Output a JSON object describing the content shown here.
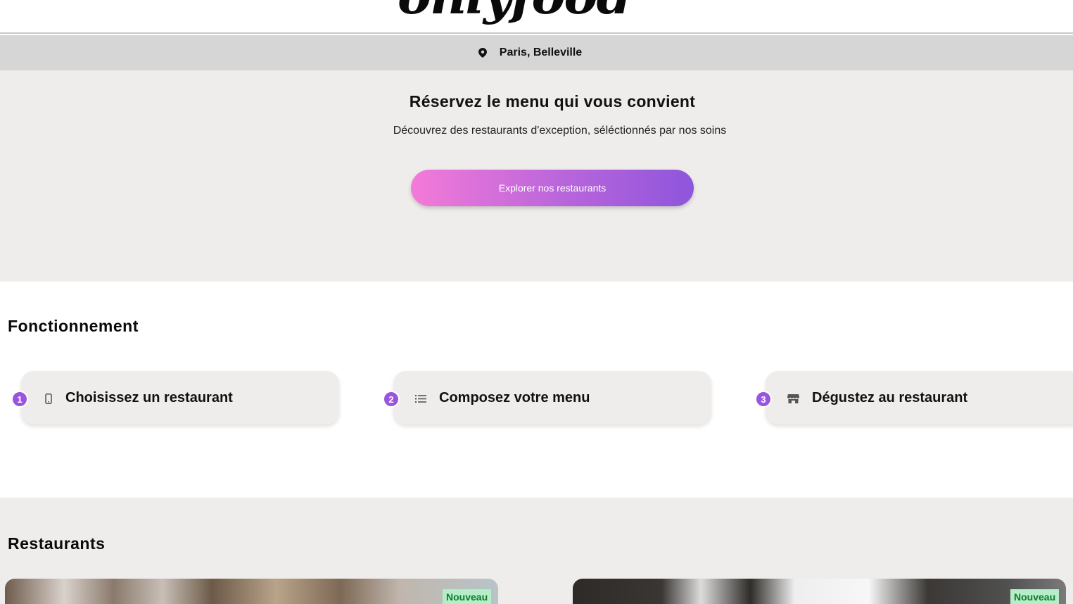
{
  "header": {
    "logo_text": "onlyfood"
  },
  "location": {
    "icon": "map-pin-icon",
    "text": "Paris, Belleville"
  },
  "hero": {
    "title": "Réservez le menu qui vous convient",
    "subtitle": "Découvrez des restaurants d'exception, séléctionnés par nos soins",
    "cta_label": "Explorer nos restaurants"
  },
  "how": {
    "title": "Fonctionnement",
    "steps": [
      {
        "number": "1",
        "icon": "phone-icon",
        "label": "Choisissez un restaurant"
      },
      {
        "number": "2",
        "icon": "list-icon",
        "label": "Composez votre menu"
      },
      {
        "number": "3",
        "icon": "store-icon",
        "label": "Dégustez au restaurant"
      }
    ]
  },
  "restaurants": {
    "title": "Restaurants",
    "cards": [
      {
        "badge": "Nouveau"
      },
      {
        "badge": "Nouveau"
      }
    ]
  },
  "colors": {
    "accent_purple": "#9a55df",
    "cta_gradient_start": "#f47ad8",
    "cta_gradient_end": "#8e55dc",
    "badge_bg": "#b4edc7",
    "badge_text": "#127a2e",
    "section_bg": "#efedeb"
  }
}
